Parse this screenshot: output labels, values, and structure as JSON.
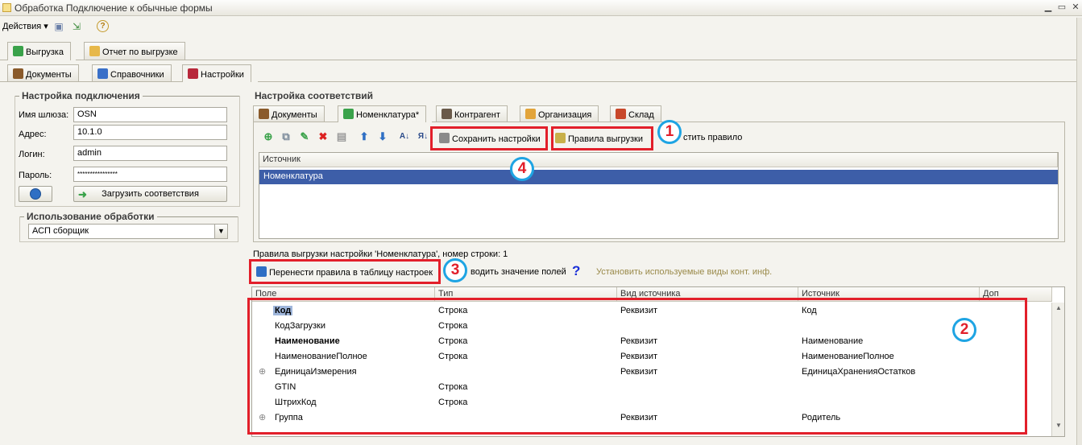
{
  "window": {
    "title": "Обработка  Подключение к обычные формы"
  },
  "toolbar": {
    "actions_label": "Действия"
  },
  "outer_tabs": [
    {
      "label": "Выгрузка"
    },
    {
      "label": "Отчет по выгрузке"
    }
  ],
  "inner_tabs": [
    {
      "label": "Документы"
    },
    {
      "label": "Справочники"
    },
    {
      "label": "Настройки"
    }
  ],
  "connection": {
    "title": "Настройка подключения",
    "gateway_label": "Имя шлюза:",
    "gateway_value": "OSN",
    "address_label": "Адрес:",
    "address_value": "10.1.0",
    "login_label": "Логин:",
    "login_value": "admin",
    "password_label": "Пароль:",
    "password_value": "****************",
    "load_button": "Загрузить соответствия"
  },
  "usage": {
    "title": "Использование обработки",
    "selected": "АСП сборщик"
  },
  "mapping": {
    "title": "Настройка соответствий",
    "tabs": [
      {
        "label": "Документы"
      },
      {
        "label": "Номенклатура*"
      },
      {
        "label": "Контрагент"
      },
      {
        "label": "Организация"
      },
      {
        "label": "Склад"
      }
    ],
    "save_settings": "Сохранить настройки",
    "export_rules": "Правила выгрузки",
    "fill_rule": "стить правило",
    "source_header": "Источник",
    "source_rows": [
      "Номенклатура"
    ]
  },
  "rules": {
    "caption": "Правила выгрузки настройки 'Номенклатура', номер строки: 1",
    "transfer_button": "Перенести правила в таблицу настроек",
    "enter_values": "водить значение полей",
    "set_kinds": "Установить используемые виды конт. инф.",
    "columns": [
      "Поле",
      "Тип",
      "Вид источника",
      "Источник",
      "Доп"
    ],
    "rows": [
      {
        "field": "Код",
        "type": "Строка",
        "kind": "Реквизит",
        "source": "Код",
        "bold": true,
        "selected": true,
        "expand": false
      },
      {
        "field": "КодЗагрузки",
        "type": "Строка",
        "kind": "",
        "source": "",
        "bold": false,
        "selected": false,
        "expand": false
      },
      {
        "field": "Наименование",
        "type": "Строка",
        "kind": "Реквизит",
        "source": "Наименование",
        "bold": true,
        "selected": false,
        "expand": false
      },
      {
        "field": "НаименованиеПолное",
        "type": "Строка",
        "kind": "Реквизит",
        "source": "НаименованиеПолное",
        "bold": false,
        "selected": false,
        "expand": false
      },
      {
        "field": "ЕдиницаИзмерения",
        "type": "",
        "kind": "Реквизит",
        "source": "ЕдиницаХраненияОстатков",
        "bold": false,
        "selected": false,
        "expand": true
      },
      {
        "field": "GTIN",
        "type": "Строка",
        "kind": "",
        "source": "",
        "bold": false,
        "selected": false,
        "expand": false
      },
      {
        "field": "ШтрихКод",
        "type": "Строка",
        "kind": "",
        "source": "",
        "bold": false,
        "selected": false,
        "expand": false
      },
      {
        "field": "Группа",
        "type": "",
        "kind": "Реквизит",
        "source": "Родитель",
        "bold": false,
        "selected": false,
        "expand": true
      }
    ]
  },
  "markers": [
    "1",
    "2",
    "3",
    "4"
  ],
  "colors": {
    "highlight_red": "#e21f2a",
    "marker_blue": "#1ea4e3",
    "selection_blue": "#3d5ea8"
  }
}
